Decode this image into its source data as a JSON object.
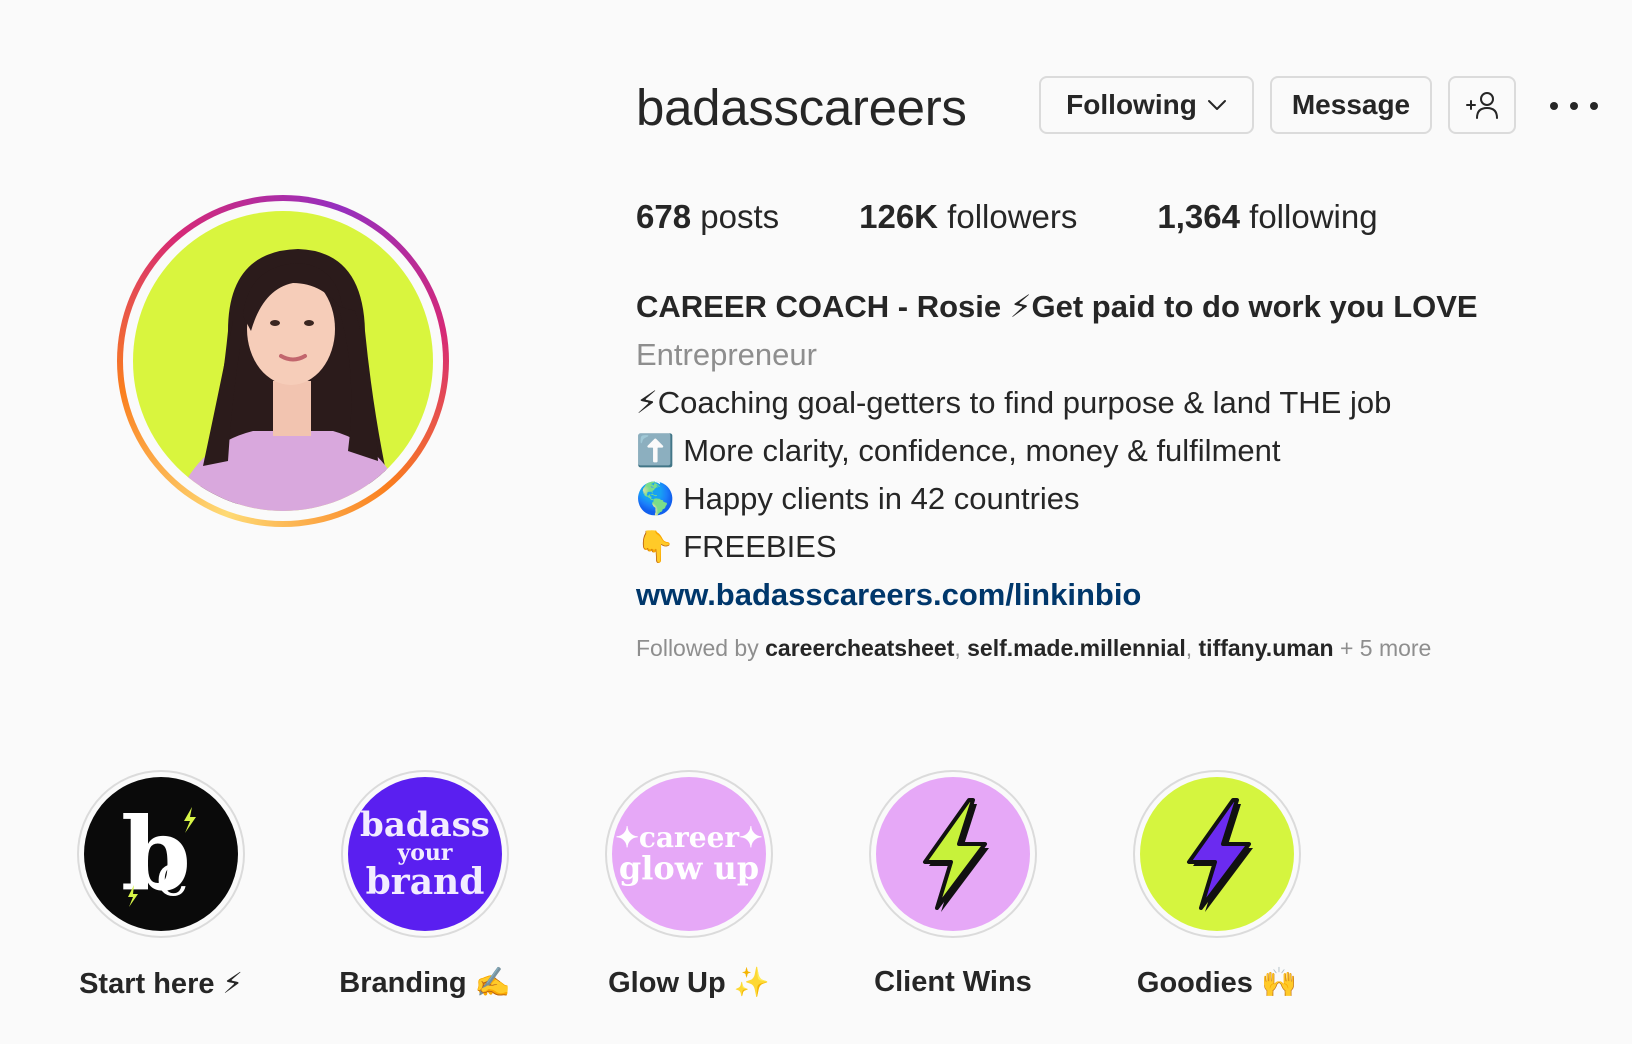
{
  "profile": {
    "username": "badasscareers",
    "buttons": {
      "following": "Following",
      "message": "Message"
    },
    "stats": {
      "posts_count": "678",
      "posts_label": "posts",
      "followers_count": "126K",
      "followers_label": "followers",
      "following_count": "1,364",
      "following_label": "following"
    },
    "bio": {
      "name": "CAREER COACH - Rosie ⚡Get paid to do work you LOVE",
      "category": "Entrepreneur",
      "lines": [
        "⚡Coaching goal-getters to find purpose & land THE job",
        "⬆️ More clarity, confidence, money & fulfilment",
        "🌎 Happy clients in 42 countries",
        "👇 FREEBIES"
      ],
      "link": "www.badasscareers.com/linkinbio"
    },
    "followed_by": {
      "prefix": "Followed by",
      "accounts": [
        "careercheatsheet",
        "self.made.millennial",
        "tiffany.uman"
      ],
      "more": "+ 5 more"
    }
  },
  "highlights": [
    {
      "label": "Start here ⚡",
      "cover_text": "bc",
      "cover_bg": "#0a0a0a",
      "cover_fg": "#ffffff",
      "accent": "#d7f547"
    },
    {
      "label": "Branding ✍️",
      "cover_text": "badass your brand",
      "cover_bg": "#5a1ff0",
      "cover_fg": "#f2ecff"
    },
    {
      "label": "Glow Up ✨",
      "cover_text": "career glow up",
      "cover_bg": "#e6a8f7",
      "cover_fg": "#ffffff"
    },
    {
      "label": "Client Wins",
      "cover_icon": "lightning-bolt-icon",
      "cover_bg": "#e6a8f7",
      "bolt_color": "#c7f23a"
    },
    {
      "label": "Goodies 🙌",
      "cover_icon": "lightning-bolt-icon",
      "cover_bg": "#d5f53f",
      "bolt_color": "#6b2bf0"
    }
  ],
  "colors": {
    "avatar_bg": "#d9f53e",
    "link": "#00376b",
    "muted": "#8e8e8e"
  }
}
